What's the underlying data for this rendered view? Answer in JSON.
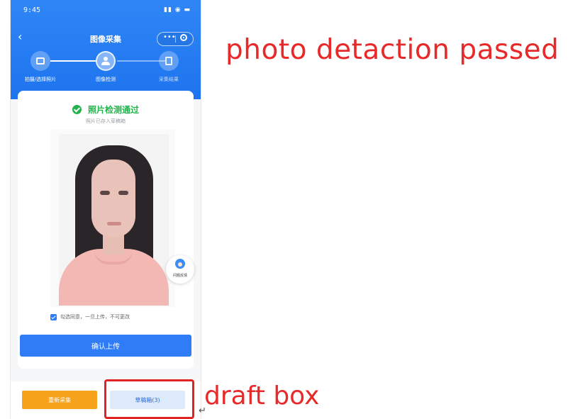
{
  "status_bar": {
    "time": "9:45",
    "icons": "▮▮ ◉ ▬"
  },
  "nav": {
    "back_label": "‹",
    "title": "图像采集",
    "more_label": "•••"
  },
  "steps": [
    {
      "label": "拍摄/选择照片",
      "icon": "image-icon",
      "state": "done"
    },
    {
      "label": "图像检测",
      "icon": "person-icon",
      "state": "active"
    },
    {
      "label": "采集结果",
      "icon": "document-icon",
      "state": "pending"
    }
  ],
  "result": {
    "title": "照片检测通过",
    "subtitle": "照片已存入草稿箱"
  },
  "agreement": {
    "text": "勾选同意，一旦上传，不可更改",
    "checked": true
  },
  "buttons": {
    "confirm": "确认上传",
    "retake": "重新采集",
    "draft": "草稿箱(3)"
  },
  "float_help": {
    "label": "问题反馈"
  },
  "annotations": {
    "top": "photo detaction passed",
    "draft": "draft box",
    "return_mark": "↵"
  },
  "colors": {
    "brand_blue": "#2f7cf6",
    "success_green": "#22b24c",
    "retake_orange": "#f7a21b",
    "annotation_red": "#e82929"
  }
}
